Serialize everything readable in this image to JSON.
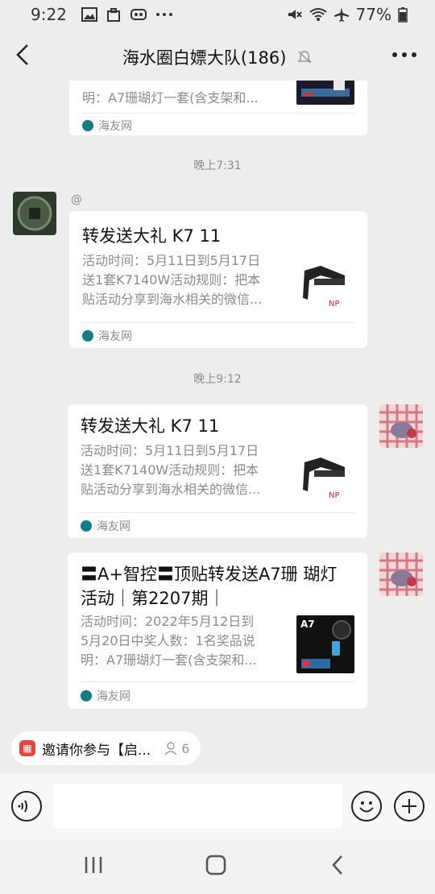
{
  "status_bar": {
    "time": "9:22",
    "battery": "77%"
  },
  "header": {
    "title": "海水圈白嫖大队(186)"
  },
  "messages": [
    {
      "desc": "明：A7珊瑚灯一套(含支架和...",
      "source": "海友网"
    },
    {
      "time": "晚上7:31"
    },
    {
      "at": "@",
      "title": "转发送大礼 K7 11",
      "desc_lines": [
        "活动时间：5月11日到5月17日",
        "送1套K7140W活动规则：把本",
        "贴活动分享到海水相关的微信..."
      ],
      "source": "海友网"
    },
    {
      "time": "晚上9:12"
    },
    {
      "title": "转发送大礼 K7 11",
      "desc_lines": [
        "活动时间：5月11日到5月17日",
        "送1套K7140W活动规则：把本",
        "贴活动分享到海水相关的微信..."
      ],
      "source": "海友网"
    },
    {
      "title_lines": [
        "〓A+智控〓顶贴转发送A7珊 瑚灯",
        "活动｜第2207期｜"
      ],
      "desc_lines": [
        "活动时间：2022年5月12日到",
        "5月20日中奖人数：1名奖品说",
        "明：A7珊瑚灯一套(含支架和..."
      ],
      "thumb_label": "A7",
      "source": "海友网"
    }
  ],
  "invite": {
    "text": "邀请你参与【启...",
    "count": "6"
  },
  "colors": {
    "background": "#ededed",
    "card": "#ffffff",
    "meta_text": "#8c8c8c",
    "invite_icon": "#e8453c"
  }
}
